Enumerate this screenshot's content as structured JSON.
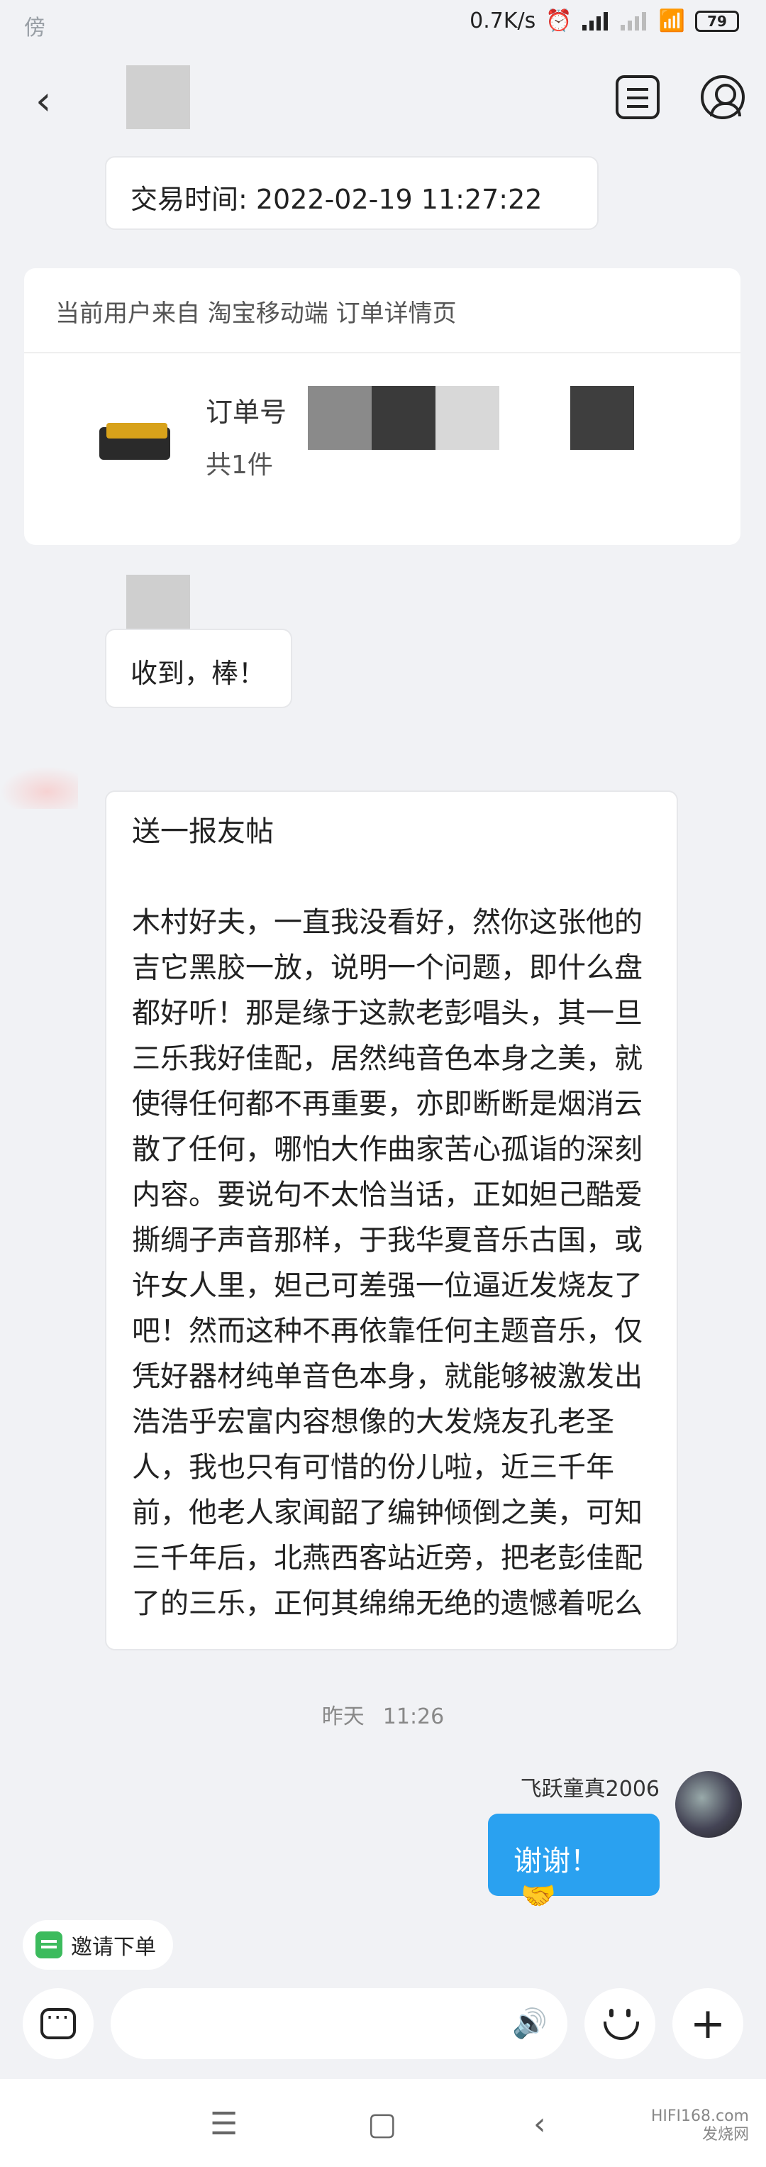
{
  "status_bar": {
    "left_text": "傍",
    "network_speed": "0.7K/s",
    "battery": "79"
  },
  "nav": {
    "back_icon": "chevron-left-icon",
    "orders_icon": "orders-list-icon",
    "profile_icon": "profile-icon"
  },
  "messages": {
    "trade_time": "交易时间: 2022-02-19 11:27:22",
    "order_card": {
      "header": "当前用户来自 淘宝移动端 订单详情页",
      "order_label": "订单号",
      "count": "共1件"
    },
    "received": "收到，棒！",
    "long_title": "送一报友帖",
    "long_body": "木村好夫，一直我没看好，然你这张他的吉它黑胶一放，说明一个问题，即什么盘都好听！那是缘于这款老彭唱头，其一旦三乐我好佳配，居然纯音色本身之美，就使得任何都不再重要，亦即断断是烟消云散了任何，哪怕大作曲家苦心孤诣的深刻内容。要说句不太恰当话，正如妲己酷爱撕绸子声音那样，于我华夏音乐古国，或许女人里，妲己可差强一位逼近发烧友了吧！然而这种不再依靠任何主题音乐，仅凭好器材纯单音色本身，就能够被激发出浩浩乎宏富内容想像的大发烧友孔老圣人，我也只有可惜的份儿啦，近三千年前，他老人家闻韶了编钟倾倒之美，可知三千年后，北燕西客站近旁，把老彭佳配了的三乐，正何其绵绵无绝的遗憾着呢么",
    "timestamp_day": "昨天",
    "timestamp_time": "11:26",
    "my_name": "飞跃童真2006",
    "thanks": "谢谢！",
    "thanks_emoji": "🤝"
  },
  "invite_button": "邀请下单",
  "input": {
    "placeholder": ""
  },
  "watermark": {
    "brand": "HIFI168.com",
    "text": "发烧网"
  },
  "colors": {
    "accent_blue": "#2aa1f0",
    "invite_green": "#3cbb5d",
    "background": "#f1f2f5"
  }
}
